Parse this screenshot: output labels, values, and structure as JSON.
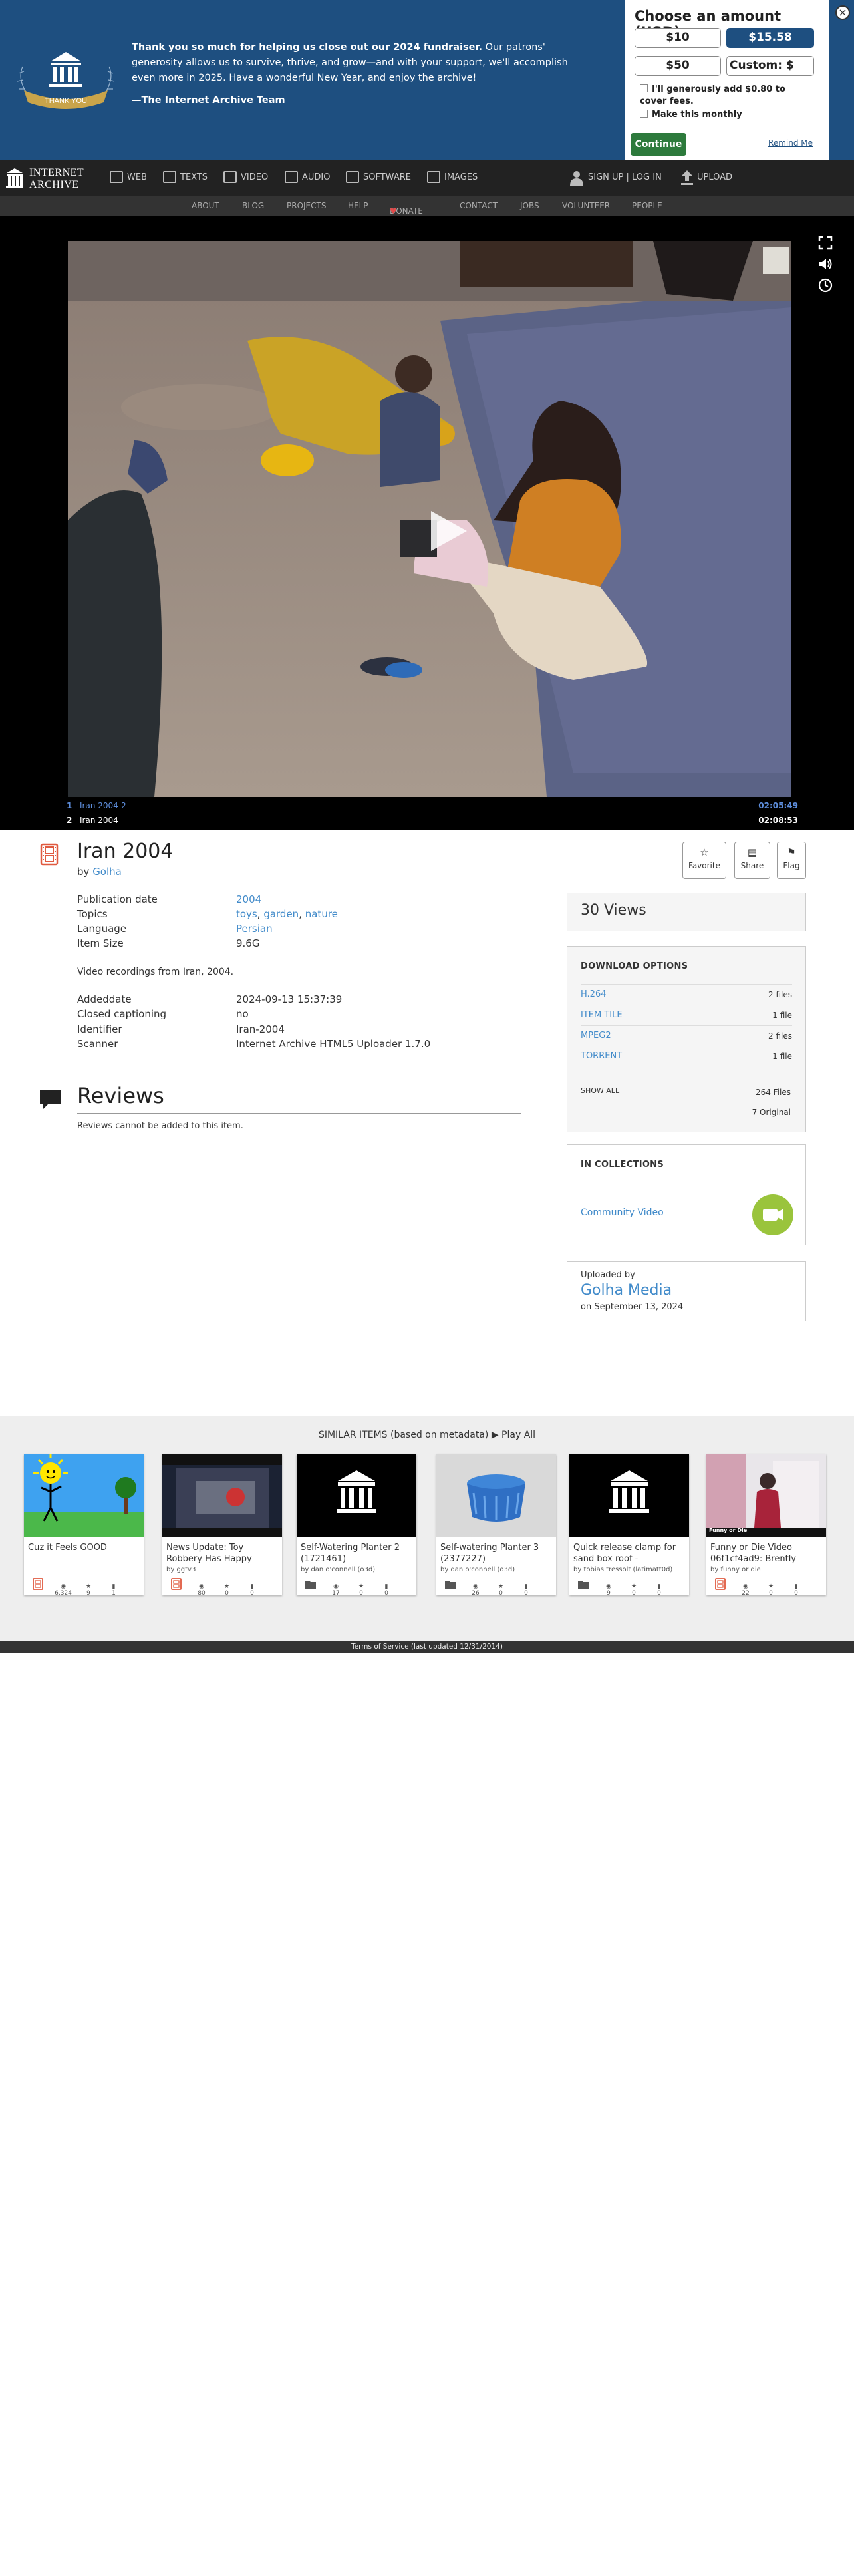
{
  "banner": {
    "seal_text": "THANK YOU",
    "message_bold": "Thank you so much for helping us close out our 2024 fundraiser.",
    "message": " Our patrons' generosity allows us to survive, thrive, and grow—and with your support, we'll accomplish even more in 2025. Have a wonderful New Year, and enjoy the archive!",
    "signature": "—The Internet Archive Team",
    "panel_title": "Choose an amount (USD)",
    "amounts": [
      "$10",
      "$15.58",
      "$50",
      "Custom: $"
    ],
    "fee_label": "I'll generously add $0.80 to cover fees.",
    "monthly_label": "Make this monthly",
    "continue_label": "Continue",
    "remind_label": "Remind Me",
    "close_label": "×",
    "colors": {
      "background": "#1e4f80",
      "selected": "#1e4f80",
      "continue": "#2d7a3c"
    }
  },
  "topnav": {
    "logo_line1": "INTERNET",
    "logo_line2": "ARCHIVE",
    "items": [
      {
        "label": "WEB",
        "icon": "web-icon"
      },
      {
        "label": "TEXTS",
        "icon": "texts-icon"
      },
      {
        "label": "VIDEO",
        "icon": "video-icon"
      },
      {
        "label": "AUDIO",
        "icon": "audio-icon"
      },
      {
        "label": "SOFTWARE",
        "icon": "software-icon"
      },
      {
        "label": "IMAGES",
        "icon": "images-icon"
      }
    ],
    "signup": "SIGN UP | LOG IN",
    "upload": "UPLOAD"
  },
  "subnav": [
    "ABOUT",
    "BLOG",
    "PROJECTS",
    "HELP",
    "DONATE",
    "CONTACT",
    "JOBS",
    "VOLUNTEER",
    "PEOPLE"
  ],
  "player": {
    "playlist": [
      {
        "num": "1",
        "title": "Iran 2004-2",
        "duration": "02:05:49"
      },
      {
        "num": "2",
        "title": "Iran 2004",
        "duration": "02:08:53"
      }
    ]
  },
  "item": {
    "title": "Iran 2004",
    "by_label": "by",
    "author": "Golha",
    "favorite": "Favorite",
    "share": "Share",
    "flag": "Flag",
    "metadata": {
      "pubdate_label": "Publication date",
      "pubdate": "2004",
      "topics_label": "Topics",
      "topics": [
        "toys",
        "garden",
        "nature"
      ],
      "language_label": "Language",
      "language": "Persian",
      "size_label": "Item Size",
      "size": "9.6G"
    },
    "description": "Video recordings from Iran, 2004.",
    "extra": {
      "addeddate_label": "Addeddate",
      "addeddate": "2024-09-13 15:37:39",
      "cc_label": "Closed captioning",
      "cc": "no",
      "identifier_label": "Identifier",
      "identifier": "Iran-2004",
      "scanner_label": "Scanner",
      "scanner": "Internet Archive HTML5 Uploader 1.7.0"
    }
  },
  "reviews": {
    "title": "Reviews",
    "note": "Reviews cannot be added to this item."
  },
  "sidebar": {
    "views": "30 Views",
    "download_title": "DOWNLOAD OPTIONS",
    "downloads": [
      {
        "format": "H.264",
        "count": "2 files"
      },
      {
        "format": "ITEM TILE",
        "count": "1 file"
      },
      {
        "format": "MPEG2",
        "count": "2 files"
      },
      {
        "format": "TORRENT",
        "count": "1 file"
      }
    ],
    "show_all": "SHOW ALL",
    "files_count": "264 Files",
    "original_count": "7 Original",
    "collections_title": "IN COLLECTIONS",
    "collection": "Community Video",
    "uploaded_by_label": "Uploaded by",
    "uploader": "Golha Media",
    "uploaded_on": "on September 13, 2024"
  },
  "similar": {
    "title": "SIMILAR ITEMS (based on metadata)",
    "play_all": "Play All",
    "items": [
      {
        "title": "Cuz it Feels GOOD",
        "by": "",
        "type": "movie-icon",
        "views": "6,324",
        "favs": "9",
        "reviews": "1"
      },
      {
        "title": "News Update: Toy Robbery Has Happy",
        "by": "by ggtv3",
        "type": "movie-icon",
        "views": "80",
        "favs": "0",
        "reviews": "0"
      },
      {
        "title": "Self-Watering Planter 2 (1721461)",
        "by": "by dan o'connell (o3d)",
        "type": "collection-icon",
        "views": "17",
        "favs": "0",
        "reviews": "0"
      },
      {
        "title": "Self-watering Planter 3 (2377227)",
        "by": "by dan o'connell (o3d)",
        "type": "collection-icon",
        "views": "26",
        "favs": "0",
        "reviews": "0"
      },
      {
        "title": "Quick release clamp for sand box roof -",
        "by": "by tobias tressolt (latimatt0d)",
        "type": "collection-icon",
        "views": "9",
        "favs": "0",
        "reviews": "0"
      },
      {
        "title": "Funny or Die Video 06f1cf4ad9: Brently",
        "by": "by funny or die",
        "type": "movie-icon",
        "views": "22",
        "favs": "0",
        "reviews": "0"
      }
    ],
    "funny_badge": "Funny or Die"
  },
  "footer": {
    "tos": "Terms of Service (last updated 12/31/2014)"
  }
}
